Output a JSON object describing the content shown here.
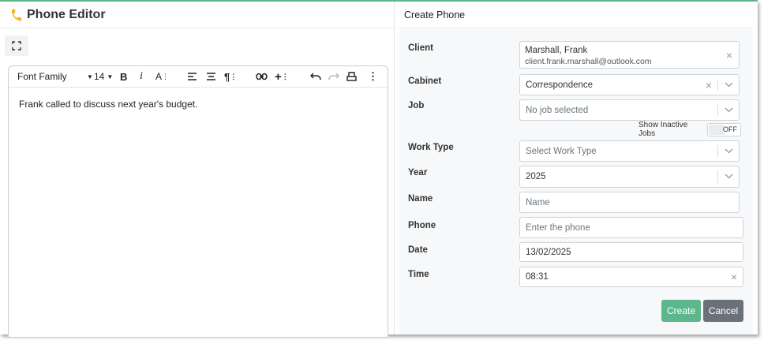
{
  "editor": {
    "title": "Phone Editor",
    "toolbar": {
      "font_family": "Font Family",
      "font_size": "14"
    },
    "content": "Frank called to discuss next year's budget."
  },
  "form": {
    "title": "Create Phone",
    "client": {
      "label": "Client",
      "name": "Marshall, Frank",
      "email": "client.frank.marshall@outlook.com"
    },
    "cabinet": {
      "label": "Cabinet",
      "value": "Correspondence"
    },
    "job": {
      "label": "Job",
      "placeholder": "No job selected"
    },
    "show_inactive": {
      "label": "Show Inactive Jobs",
      "state": "OFF"
    },
    "work_type": {
      "label": "Work Type",
      "placeholder": "Select Work Type"
    },
    "year": {
      "label": "Year",
      "value": "2025"
    },
    "name": {
      "label": "Name",
      "placeholder": "Name"
    },
    "phone": {
      "label": "Phone",
      "placeholder": "Enter the phone"
    },
    "date": {
      "label": "Date",
      "value": "13/02/2025"
    },
    "time": {
      "label": "Time",
      "value": "08:31"
    },
    "buttons": {
      "create": "Create",
      "cancel": "Cancel"
    }
  },
  "colors": {
    "accent": "#5cb88c",
    "phone_icon": "#f0b323",
    "cancel_button": "#6b7178"
  }
}
